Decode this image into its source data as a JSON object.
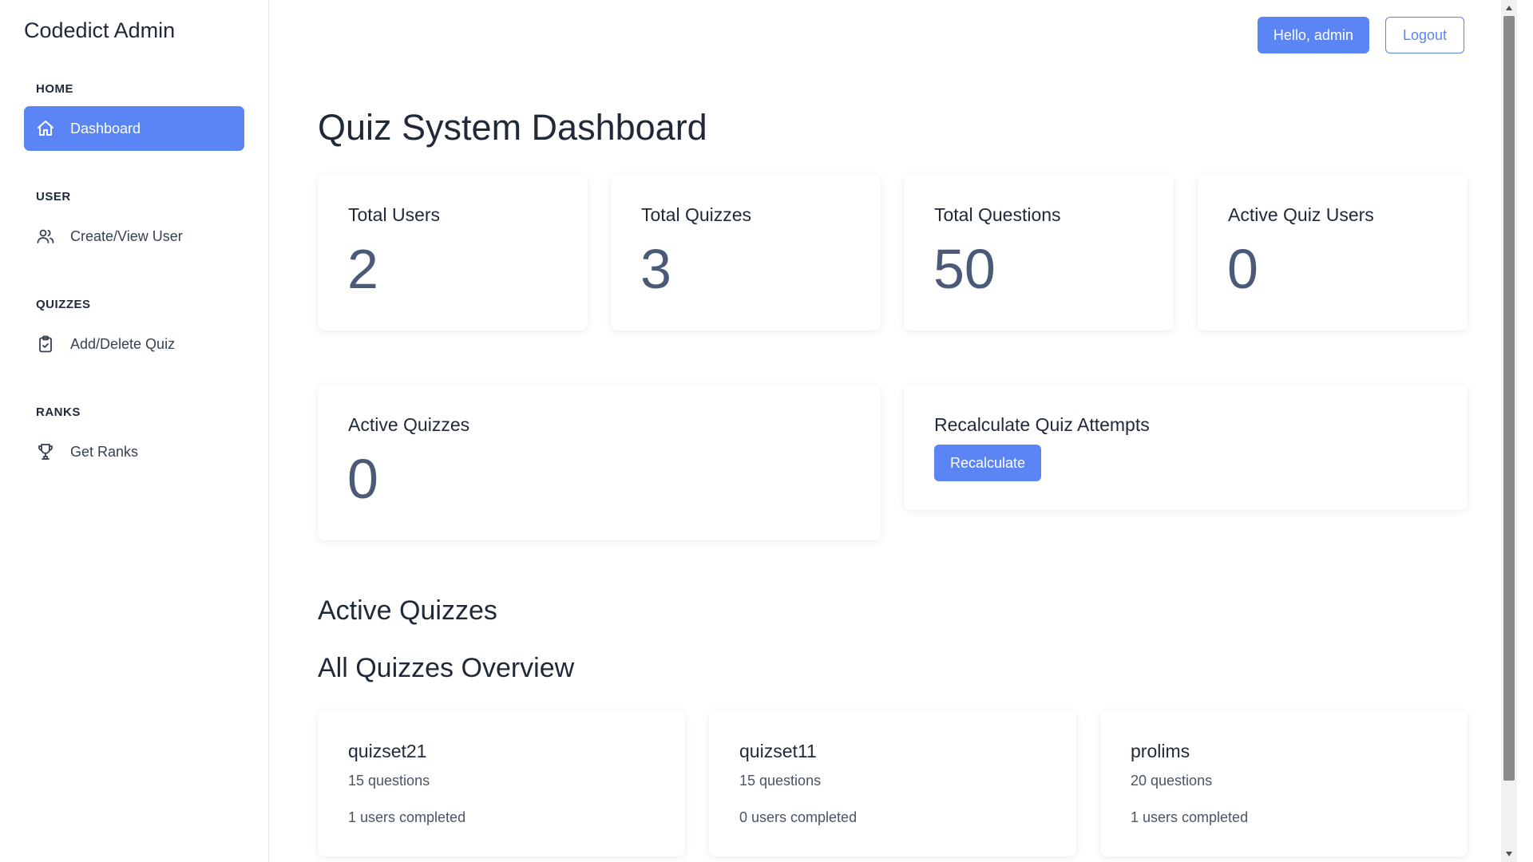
{
  "brand": "Codedict Admin",
  "sidebar": {
    "sections": [
      {
        "label": "HOME",
        "items": [
          {
            "label": "Dashboard",
            "icon": "home-icon",
            "active": true
          }
        ]
      },
      {
        "label": "USER",
        "items": [
          {
            "label": "Create/View User",
            "icon": "users-icon",
            "active": false
          }
        ]
      },
      {
        "label": "QUIZZES",
        "items": [
          {
            "label": "Add/Delete Quiz",
            "icon": "clipboard-check-icon",
            "active": false
          }
        ]
      },
      {
        "label": "RANKS",
        "items": [
          {
            "label": "Get Ranks",
            "icon": "trophy-icon",
            "active": false
          }
        ]
      }
    ]
  },
  "topbar": {
    "greeting": "Hello, admin",
    "logout": "Logout"
  },
  "page_title": "Quiz System Dashboard",
  "stats": [
    {
      "label": "Total Users",
      "value": "2"
    },
    {
      "label": "Total Quizzes",
      "value": "3"
    },
    {
      "label": "Total Questions",
      "value": "50"
    },
    {
      "label": "Active Quiz Users",
      "value": "0"
    }
  ],
  "active_quizzes_card": {
    "label": "Active Quizzes",
    "value": "0"
  },
  "recalculate_card": {
    "label": "Recalculate Quiz Attempts",
    "button": "Recalculate"
  },
  "sections": {
    "active_quizzes": "Active Quizzes",
    "all_quizzes": "All Quizzes Overview"
  },
  "quizzes": [
    {
      "name": "quizset21",
      "questions": "15 questions",
      "completed": "1 users completed"
    },
    {
      "name": "quizset11",
      "questions": "15 questions",
      "completed": "0 users completed"
    },
    {
      "name": "prolims",
      "questions": "20 questions",
      "completed": "1 users completed"
    }
  ],
  "colors": {
    "accent": "#5b85f5",
    "stat_value": "#4b5a77",
    "text": "#1f2937"
  }
}
